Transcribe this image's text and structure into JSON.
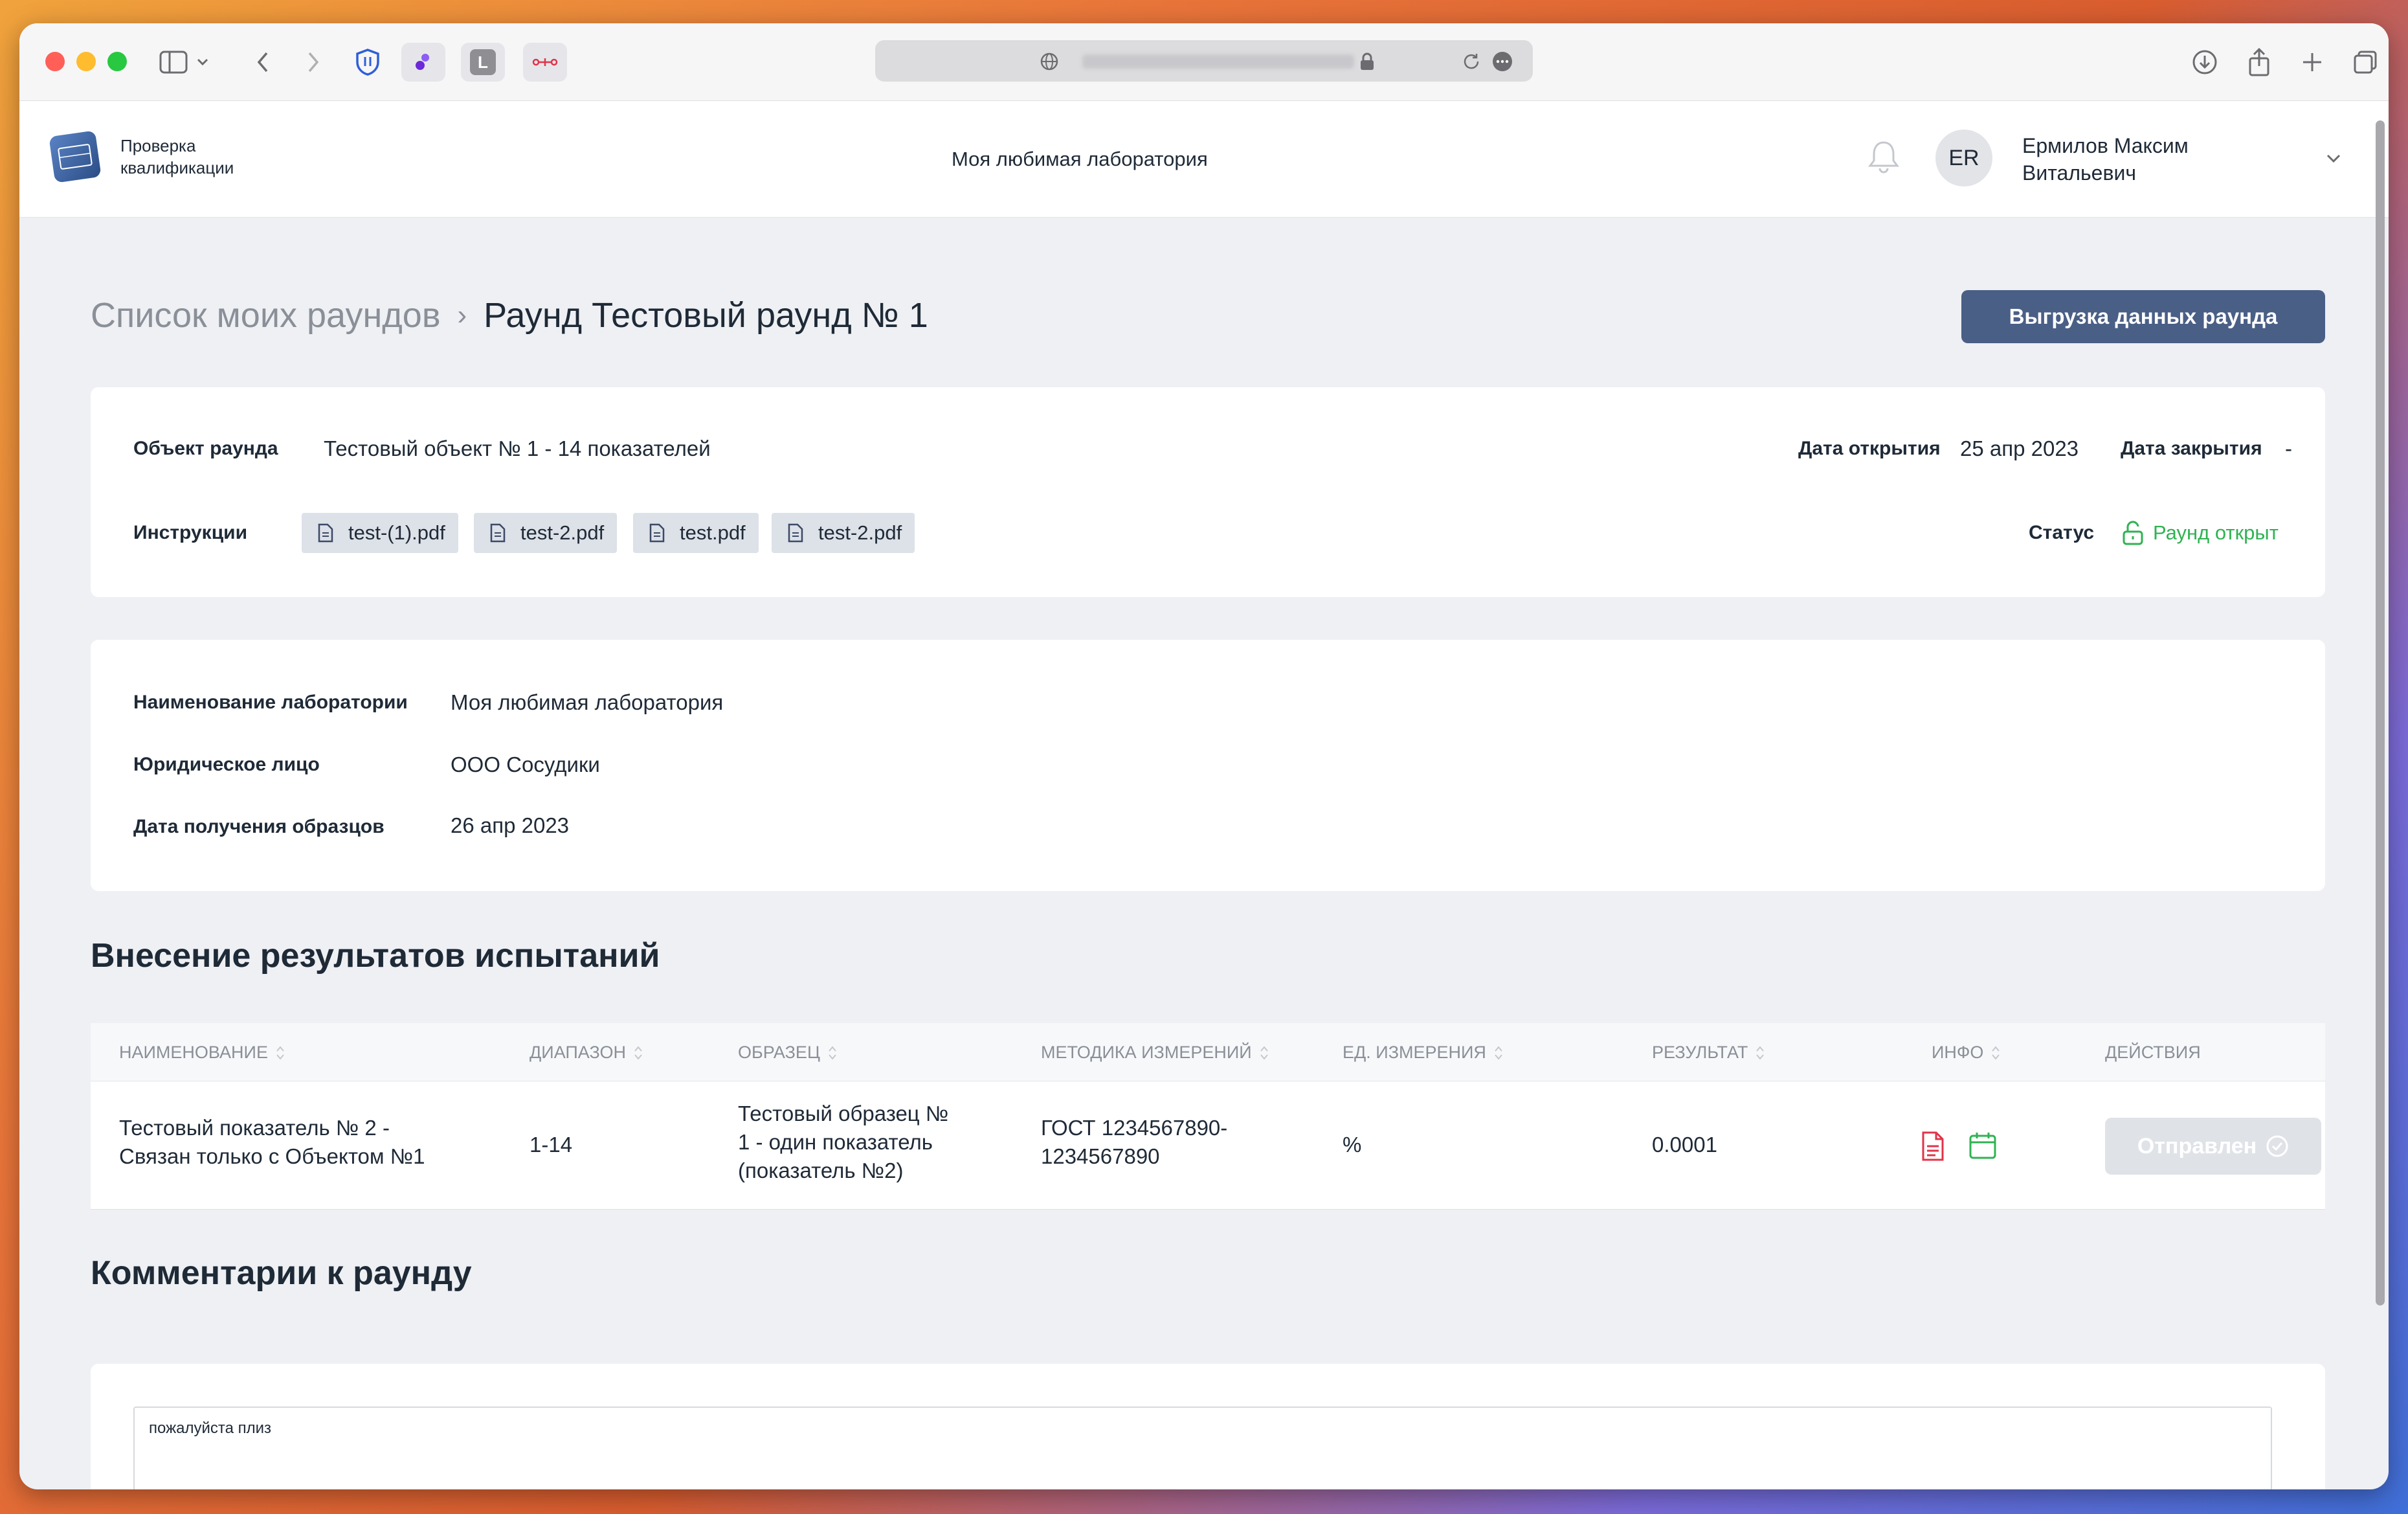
{
  "browser": {
    "url_obscured": "",
    "icons": [
      "sidebar-icon",
      "back-icon",
      "forward-icon",
      "shield-extension-icon",
      "extension-icon",
      "l-extension-icon",
      "link-extension-icon",
      "globe-icon",
      "lock-icon",
      "reload-icon",
      "more-icon",
      "download-icon",
      "share-icon",
      "new-tab-icon",
      "tabs-overview-icon"
    ],
    "ext_l_label": "L"
  },
  "header": {
    "logo_line1": "Проверка",
    "logo_line2": "квалификации",
    "lab_name": "Моя любимая лаборатория",
    "avatar_initials": "ER",
    "user_line1": "Ермилов Максим",
    "user_line2": "Витальевич"
  },
  "breadcrumb": {
    "parent": "Список моих раундов",
    "separator": "›",
    "current": "Раунд Тестовый раунд № 1"
  },
  "export_button": "Выгрузка данных раунда",
  "round": {
    "object_label": "Объект раунда",
    "object_value": "Тестовый объект № 1 - 14 показателей",
    "open_date_label": "Дата открытия",
    "open_date_value": "25 апр 2023",
    "close_date_label": "Дата закрытия",
    "close_date_value": "-",
    "instructions_label": "Инструкции",
    "files": [
      "test-(1).pdf",
      "test-2.pdf",
      "test.pdf",
      "test-2.pdf"
    ],
    "status_label": "Статус",
    "status_value": "Раунд открыт",
    "status_color": "#2fb352"
  },
  "lab": {
    "name_label": "Наименование лаборатории",
    "name_value": "Моя любимая лаборатория",
    "legal_label": "Юридическое лицо",
    "legal_value": "ООО Сосудики",
    "received_label": "Дата получения образцов",
    "received_value": "26 апр 2023"
  },
  "results": {
    "title": "Внесение результатов испытаний",
    "columns": [
      "НАИМЕНОВАНИЕ",
      "ДИАПАЗОН",
      "ОБРАЗЕЦ",
      "МЕТОДИКА ИЗМЕРЕНИЙ",
      "ЕД. ИЗМЕРЕНИЯ",
      "РЕЗУЛЬТАТ",
      "ИНФО",
      "ДЕЙСТВИЯ"
    ],
    "rows": [
      {
        "name_line1": "Тестовый показатель № 2 -",
        "name_line2": "Связан только с Объектом №1",
        "range": "1-14",
        "sample_line1": "Тестовый образец №",
        "sample_line2": "1 - один показатель",
        "sample_line3": "(показатель №2)",
        "method_line1": "ГОСТ 1234567890-",
        "method_line2": "1234567890",
        "unit": "%",
        "result": "0.0001",
        "info_icons": [
          "document-icon",
          "calendar-icon"
        ],
        "action": "Отправлен"
      }
    ]
  },
  "comments": {
    "title": "Комментарии к раунду",
    "text": "пожалуйста плиз"
  },
  "colors": {
    "accent_button": "#4a5f86",
    "page_bg": "#eef0f4",
    "doc_icon": "#e0344a",
    "calendar_icon": "#2fb352"
  }
}
